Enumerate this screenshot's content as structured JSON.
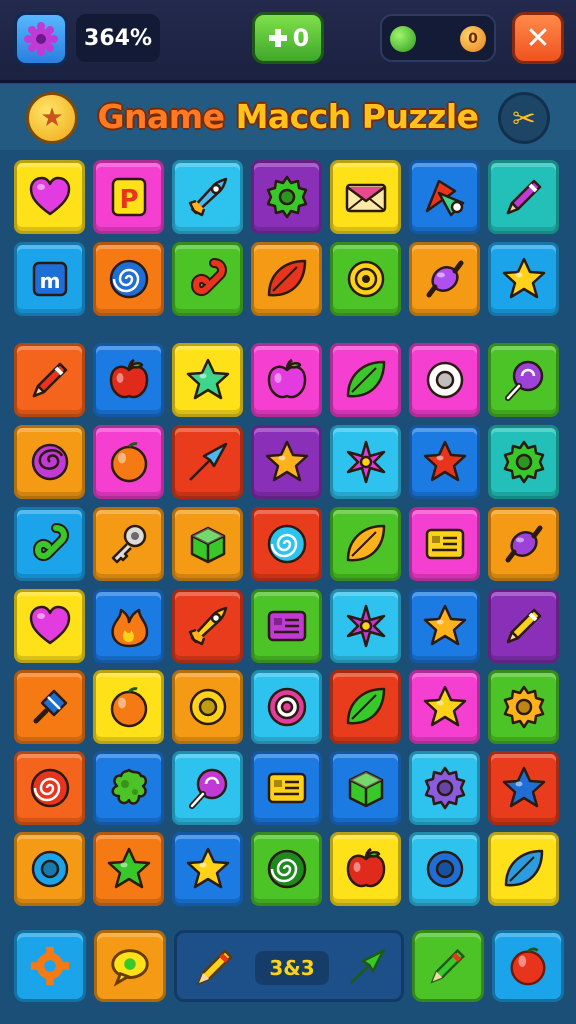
{
  "header": {
    "percent": "364%",
    "plus_label": "0",
    "coin_value": "0",
    "close_symbol": "✕"
  },
  "title": {
    "part1": "Gname",
    "part2": "Macch Puzzle"
  },
  "board": {
    "tiles": [
      {
        "bg": "#ffe11a",
        "icon": "heart-icon",
        "c": "#e23ce0"
      },
      {
        "bg": "#f43fd0",
        "icon": "p-badge-icon",
        "c": "#e8341c"
      },
      {
        "bg": "#2ec2ee",
        "icon": "rocket-icon",
        "c": "#4db8f0"
      },
      {
        "bg": "#8a2fb8",
        "icon": "gear-icon",
        "c": "#38c82a"
      },
      {
        "bg": "#ffe11a",
        "icon": "envelope-icon",
        "c": "#e5498e"
      },
      {
        "bg": "#1c7be3",
        "icon": "kite-icon",
        "c": "#e8341c"
      },
      {
        "bg": "#22c0b8",
        "icon": "pencil-icon",
        "c": "#c23ad6"
      },
      {
        "bg": "#1ca4ea",
        "icon": "m-badge-icon",
        "c": "#1f6ed6"
      },
      {
        "bg": "#f57a14",
        "icon": "spiral-icon",
        "c": "#1f6ed6"
      },
      {
        "bg": "#4cc326",
        "icon": "hook-icon",
        "c": "#e8341c"
      },
      {
        "bg": "#f59a14",
        "icon": "leaf-icon",
        "c": "#e8341c"
      },
      {
        "bg": "#4cc326",
        "icon": "snail-icon",
        "c": "#ffd21a"
      },
      {
        "bg": "#f59a14",
        "icon": "candy-icon",
        "c": "#b04ef0"
      },
      {
        "bg": "#1ca4ea",
        "icon": "star-icon",
        "c": "#ffd21a"
      },
      {
        "bg": "#f5641c",
        "icon": "pencil-icon",
        "c": "#e8341c"
      },
      {
        "bg": "#1c7be3",
        "icon": "apple-icon",
        "c": "#e02a1c"
      },
      {
        "bg": "#ffe11a",
        "icon": "star-icon",
        "c": "#3ed68a"
      },
      {
        "bg": "#f43fd0",
        "icon": "apple-icon",
        "c": "#e23ce0"
      },
      {
        "bg": "#f43fd0",
        "icon": "leaf-icon",
        "c": "#38c82a"
      },
      {
        "bg": "#f43fd0",
        "icon": "ring-icon",
        "c": "#ffffff"
      },
      {
        "bg": "#4cc326",
        "icon": "lollipop-icon",
        "c": "#9c42d8"
      },
      {
        "bg": "#f59a14",
        "icon": "rose-icon",
        "c": "#c23ad6"
      },
      {
        "bg": "#f43fd0",
        "icon": "orange-icon",
        "c": "#f57a14"
      },
      {
        "bg": "#e83c1c",
        "icon": "arrow-icon",
        "c": "#4db8f0"
      },
      {
        "bg": "#8a2fb8",
        "icon": "star-icon",
        "c": "#ffb21a"
      },
      {
        "bg": "#2ec2ee",
        "icon": "flower-icon",
        "c": "#e23ce0"
      },
      {
        "bg": "#1c7be3",
        "icon": "star-icon",
        "c": "#e8341c"
      },
      {
        "bg": "#22c0b8",
        "icon": "gear-icon",
        "c": "#38c82a"
      },
      {
        "bg": "#1ca4ea",
        "icon": "hook-icon",
        "c": "#38c82a"
      },
      {
        "bg": "#f59a14",
        "icon": "key-icon",
        "c": "#dcdcdc"
      },
      {
        "bg": "#f59a14",
        "icon": "cube-icon",
        "c": "#38c82a"
      },
      {
        "bg": "#e83c1c",
        "icon": "spiral-icon",
        "c": "#2ec2ee"
      },
      {
        "bg": "#4cc326",
        "icon": "leaf-icon",
        "c": "#ffb21a"
      },
      {
        "bg": "#f43fd0",
        "icon": "card-icon",
        "c": "#ffd21a"
      },
      {
        "bg": "#f59a14",
        "icon": "candy-icon",
        "c": "#9c42d8"
      },
      {
        "bg": "#ffe11a",
        "icon": "heart-icon",
        "c": "#e23ce0"
      },
      {
        "bg": "#1c7be3",
        "icon": "flame-icon",
        "c": "#f57a14"
      },
      {
        "bg": "#e83c1c",
        "icon": "rocket-icon",
        "c": "#ffd21a"
      },
      {
        "bg": "#4cc326",
        "icon": "card-icon",
        "c": "#c23ad6"
      },
      {
        "bg": "#2ec2ee",
        "icon": "flower-icon",
        "c": "#c23ad6"
      },
      {
        "bg": "#1c7be3",
        "icon": "star-icon",
        "c": "#ffb21a"
      },
      {
        "bg": "#8a2fb8",
        "icon": "pencil-icon",
        "c": "#ffd21a"
      },
      {
        "bg": "#f57a14",
        "icon": "pin-icon",
        "c": "#1f6ed6"
      },
      {
        "bg": "#ffe11a",
        "icon": "orange-icon",
        "c": "#f57a14"
      },
      {
        "bg": "#f59a14",
        "icon": "ring-icon",
        "c": "#ffd21a"
      },
      {
        "bg": "#2ec2ee",
        "icon": "target-icon",
        "c": "#e23c9c"
      },
      {
        "bg": "#e83c1c",
        "icon": "leaf-icon",
        "c": "#38c82a"
      },
      {
        "bg": "#f43fd0",
        "icon": "star-icon",
        "c": "#ffd21a"
      },
      {
        "bg": "#4cc326",
        "icon": "gear-icon",
        "c": "#ffb21a"
      },
      {
        "bg": "#f5641c",
        "icon": "spiral-icon",
        "c": "#e8341c"
      },
      {
        "bg": "#1c7be3",
        "icon": "splat-icon",
        "c": "#4cc326"
      },
      {
        "bg": "#2ec2ee",
        "icon": "lollipop-icon",
        "c": "#c23ad6"
      },
      {
        "bg": "#1c7be3",
        "icon": "card-icon",
        "c": "#ffd21a"
      },
      {
        "bg": "#1c7be3",
        "icon": "cube-icon",
        "c": "#38c82a"
      },
      {
        "bg": "#2ec2ee",
        "icon": "gear-icon",
        "c": "#8a5ce0"
      },
      {
        "bg": "#e83c1c",
        "icon": "star-icon",
        "c": "#1f6ed6"
      },
      {
        "bg": "#f59a14",
        "icon": "ring-icon",
        "c": "#1ca4ea"
      },
      {
        "bg": "#f57a14",
        "icon": "star-icon",
        "c": "#38c82a"
      },
      {
        "bg": "#1c7be3",
        "icon": "star-icon",
        "c": "#ffd21a"
      },
      {
        "bg": "#4cc326",
        "icon": "spiral-icon",
        "c": "#1e8a1e"
      },
      {
        "bg": "#ffe11a",
        "icon": "apple-icon",
        "c": "#e02a1c"
      },
      {
        "bg": "#2ec2ee",
        "icon": "ring-icon",
        "c": "#1f6ed6"
      },
      {
        "bg": "#ffe11a",
        "icon": "leaf-icon",
        "c": "#2e9ae0"
      }
    ]
  },
  "footer": {
    "counter": "3&3",
    "left_icon": "gear-icon",
    "right_icon": "orange-icon"
  },
  "colors": {
    "background": "#1c4f78",
    "topbar": "#232a4d",
    "title": "#ffc21a",
    "title_accent": "#ff7a22"
  }
}
